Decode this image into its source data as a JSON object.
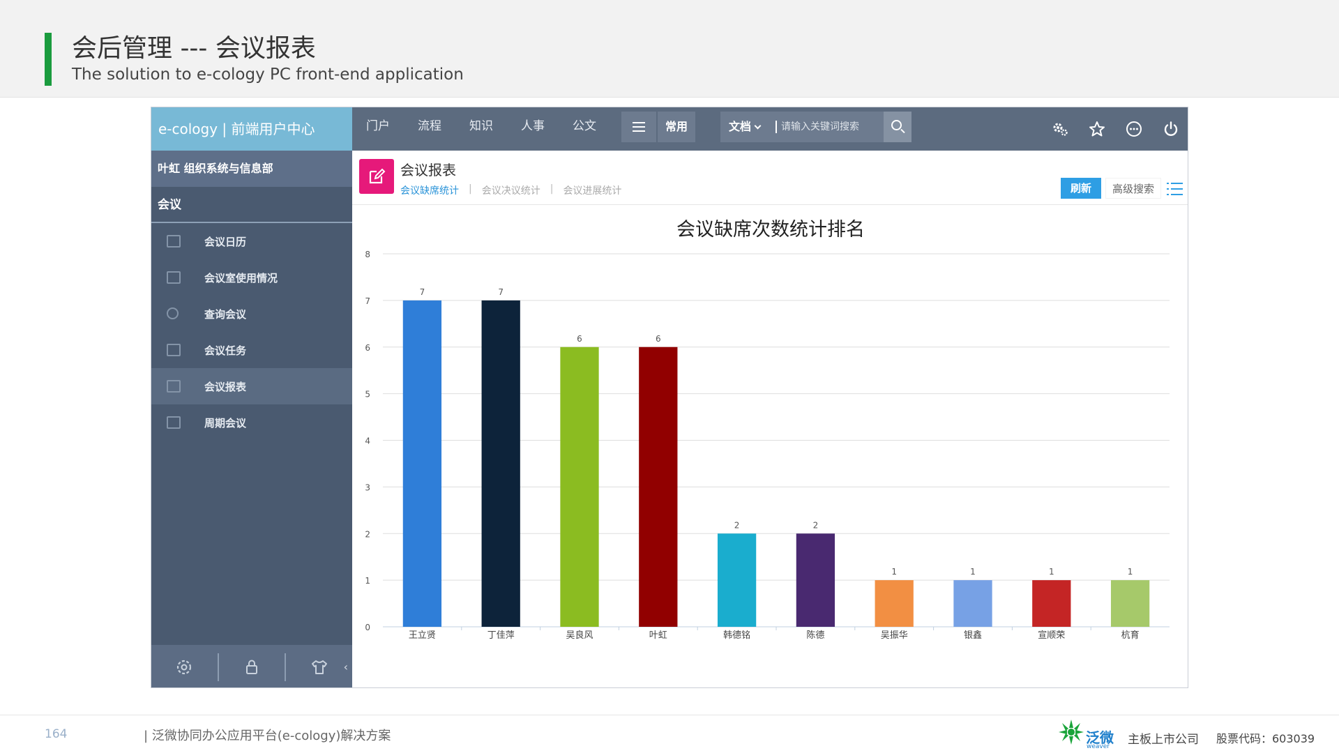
{
  "slide": {
    "title": "会后管理 --- 会议报表",
    "subtitle": "The solution to e-cology PC front-end application",
    "page_number": "164",
    "footer_text": "| 泛微协同办公应用平台(e-cology)解决方案",
    "logo_text": "泛微",
    "logo_subtext": "weaver",
    "listed_text": "主板上市公司",
    "stock_text": "股票代码：603039",
    "accent_color": "#1a9b3e"
  },
  "app": {
    "brand": "e-cology | 前端用户中心",
    "nav": [
      "门户",
      "流程",
      "知识",
      "人事",
      "公文"
    ],
    "menu_icon": "hamburger-icon",
    "common_label": "常用",
    "search": {
      "type_label": "文档",
      "placeholder": "请输入关键词搜索"
    },
    "top_icons": [
      "settings-icon",
      "star-icon",
      "more-icon",
      "power-icon"
    ]
  },
  "sidebar": {
    "user": "叶虹  组织系统与信息部",
    "section": "会议",
    "items": [
      {
        "label": "会议日历",
        "icon": "calendar-icon"
      },
      {
        "label": "会议室使用情况",
        "icon": "room-icon"
      },
      {
        "label": "查询会议",
        "icon": "search-icon"
      },
      {
        "label": "会议任务",
        "icon": "task-icon"
      },
      {
        "label": "会议报表",
        "icon": "report-icon",
        "active": true
      },
      {
        "label": "周期会议",
        "icon": "cycle-icon"
      }
    ],
    "footer_icons": [
      "settings-icon",
      "lock-icon",
      "shirt-icon"
    ],
    "collapse_glyph": "‹"
  },
  "content": {
    "heading": "会议报表",
    "tabs": [
      "会议缺席统计",
      "会议决议统计",
      "会议进展统计"
    ],
    "active_tab": 0,
    "refresh_label": "刷新",
    "advanced_search_label": "高级搜索",
    "module_icon_color": "#e6197a"
  },
  "chart_data": {
    "type": "bar",
    "title": "会议缺席次数统计排名",
    "categories": [
      "王立贤",
      "丁佳萍",
      "吴良风",
      "叶虹",
      "韩德铭",
      "陈德",
      "吴振华",
      "银鑫",
      "宣顺荣",
      "杭育"
    ],
    "values": [
      7,
      7,
      6,
      6,
      2,
      2,
      1,
      1,
      1,
      1
    ],
    "colors": [
      "#2f7ed8",
      "#0d233a",
      "#8bbc21",
      "#910000",
      "#1aadce",
      "#492970",
      "#f28f43",
      "#77a1e5",
      "#c42525",
      "#a6c96a"
    ],
    "ylim": [
      0,
      8
    ],
    "yticks": [
      0,
      1,
      2,
      3,
      4,
      5,
      6,
      7,
      8
    ],
    "grid": true,
    "xlabel": "",
    "ylabel": ""
  }
}
